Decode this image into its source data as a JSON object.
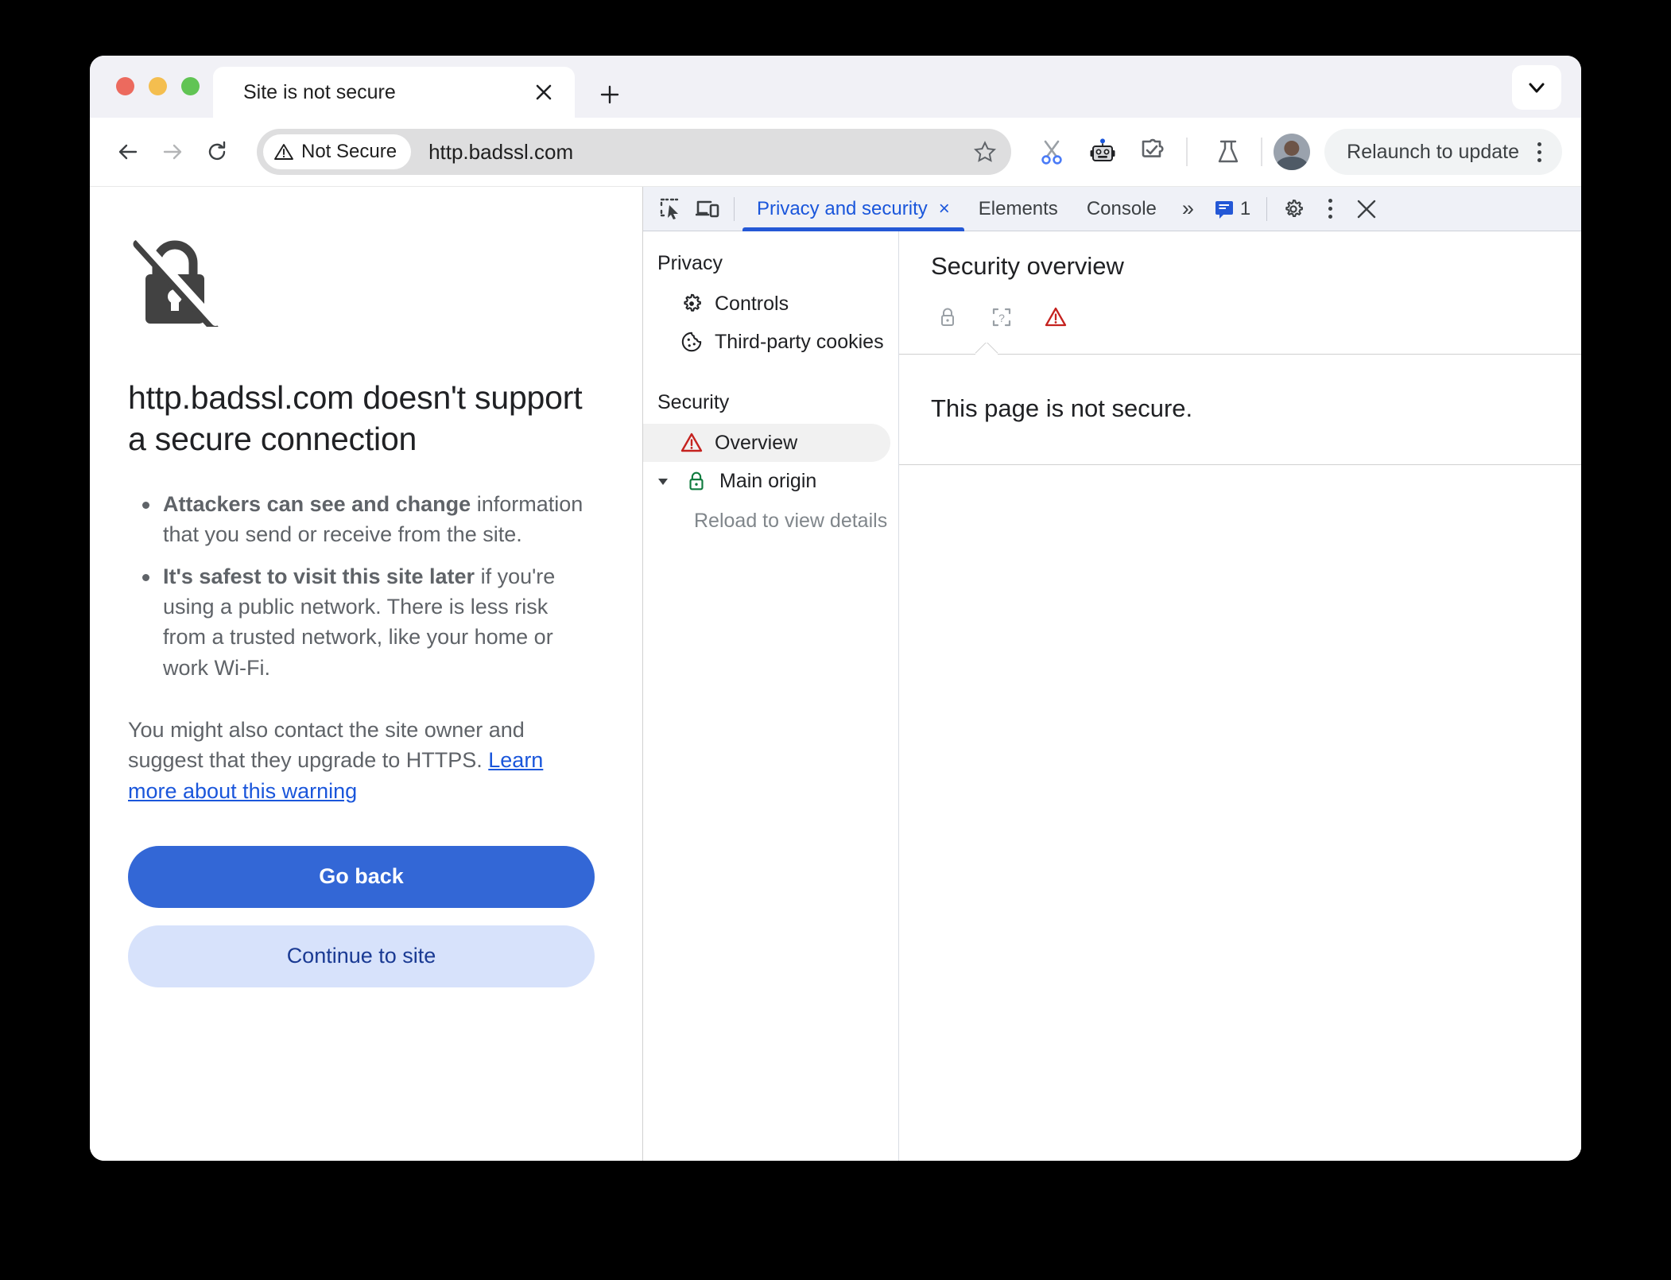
{
  "browser": {
    "tab": {
      "title": "Site is not secure",
      "close_label": "×"
    },
    "new_tab_label": "+",
    "tab_search_name": "chevron-down-icon",
    "toolbar": {
      "back_name": "back-arrow-icon",
      "forward_name": "forward-arrow-icon",
      "reload_name": "reload-icon",
      "security_badge": "Not Secure",
      "url": "http.badssl.com",
      "bookmark_name": "star-icon",
      "icons": [
        "scissors-icon",
        "robot-icon",
        "extension-puzzle-icon",
        "flask-icon"
      ],
      "relaunch_label": "Relaunch to update",
      "menu_name": "kebab-menu-icon"
    }
  },
  "page": {
    "icon": "broken-lock-icon",
    "heading": "http.badssl.com doesn't support a secure connection",
    "bullets": [
      {
        "bold": "Attackers can see and change",
        "rest": " information that you send or receive from the site."
      },
      {
        "bold": "It's safest to visit this site later",
        "rest": " if you're using a public network. There is less risk from a trusted network, like your home or work Wi-Fi."
      }
    ],
    "paragraph_text": "You might also contact the site owner and suggest that they upgrade to HTTPS. ",
    "paragraph_link": "Learn more about this warning",
    "primary_button": "Go back",
    "secondary_button": "Continue to site"
  },
  "devtools": {
    "toolbar": {
      "inspect_name": "inspect-element-icon",
      "device_name": "device-toolbar-icon",
      "tabs": [
        {
          "label": "Privacy and security",
          "active": true,
          "closable": true,
          "close_label": "×"
        },
        {
          "label": "Elements",
          "active": false
        },
        {
          "label": "Console",
          "active": false
        }
      ],
      "more_tabs_label": "»",
      "issues_count": "1",
      "settings_name": "gear-icon",
      "menu_name": "kebab-menu-icon",
      "close_name": "close-icon",
      "close_label": "✕"
    },
    "sidebar": {
      "privacy_header": "Privacy",
      "privacy_items": [
        {
          "label": "Controls",
          "icon": "gear-icon"
        },
        {
          "label": "Third-party cookies",
          "icon": "cookie-icon"
        }
      ],
      "security_header": "Security",
      "security_items": [
        {
          "label": "Overview",
          "icon": "warning-triangle-icon",
          "selected": true
        },
        {
          "label": "Main origin",
          "icon": "green-lock-icon",
          "expanded": true
        }
      ],
      "reload_hint": "Reload to view details"
    },
    "main": {
      "title": "Security overview",
      "chips": [
        {
          "name": "lock-icon",
          "state": "inactive"
        },
        {
          "name": "unknown-certificate-icon",
          "state": "inactive"
        },
        {
          "name": "warning-triangle-icon",
          "state": "active"
        }
      ],
      "statement": "This page is not secure."
    }
  },
  "colors": {
    "accent_blue": "#3367d6",
    "link_blue": "#1a56db",
    "devtools_blue": "#2458d6",
    "warning_red": "#c5221f",
    "secure_green": "#0f7b3e"
  }
}
